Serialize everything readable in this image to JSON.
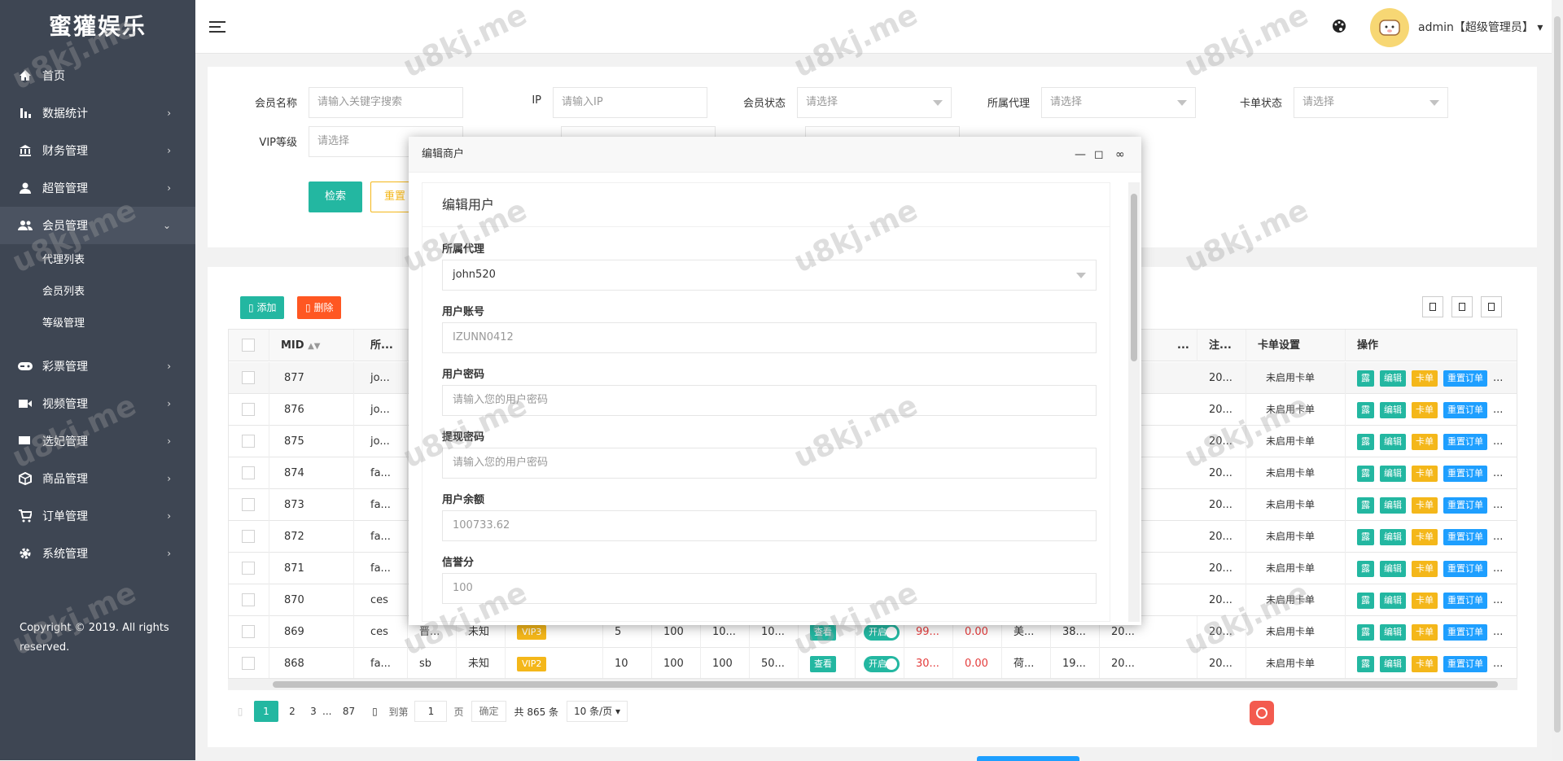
{
  "app": {
    "title": "蜜獾娱乐"
  },
  "sidebar": {
    "items": [
      {
        "label": "首页",
        "icon": "home-icon"
      },
      {
        "label": "数据统计",
        "icon": "bar-chart-icon"
      },
      {
        "label": "财务管理",
        "icon": "bank-icon"
      },
      {
        "label": "超管管理",
        "icon": "user-icon"
      },
      {
        "label": "会员管理",
        "icon": "users-icon"
      },
      {
        "label": "彩票管理",
        "icon": "gamepad-icon"
      },
      {
        "label": "视频管理",
        "icon": "video-icon"
      },
      {
        "label": "选妃管理",
        "icon": "flag-icon"
      },
      {
        "label": "商品管理",
        "icon": "box-icon"
      },
      {
        "label": "订单管理",
        "icon": "cart-icon"
      },
      {
        "label": "系统管理",
        "icon": "gear-icon"
      }
    ],
    "sub_items": [
      "代理列表",
      "会员列表",
      "等级管理"
    ],
    "copyright": "Copyright © 2019. All rights reserved."
  },
  "header": {
    "user": "admin【超级管理员】"
  },
  "filters": {
    "member_name": {
      "label": "会员名称",
      "placeholder": "请输入关键字搜索"
    },
    "ip": {
      "label": "IP",
      "placeholder": "请输入IP"
    },
    "member_status": {
      "label": "会员状态",
      "placeholder": "请选择"
    },
    "agent": {
      "label": "所属代理",
      "placeholder": "请选择"
    },
    "card_status": {
      "label": "卡单状态",
      "placeholder": "请选择"
    },
    "vip_level": {
      "label": "VIP等级",
      "placeholder": "请选择"
    },
    "search_btn": "检索",
    "reset_btn": "重置"
  },
  "toolbar": {
    "add": "添加",
    "delete": "删除"
  },
  "table": {
    "headers": {
      "mid": "MID",
      "agent": "所...",
      "reg": "注...",
      "card": "卡单设置",
      "ops": "操作",
      "trunc": "..."
    },
    "rows": [
      {
        "mid": "877",
        "agent": "jo...",
        "reg": "20...",
        "card": "未启用卡单"
      },
      {
        "mid": "876",
        "agent": "jo...",
        "reg": "20...",
        "card": "未启用卡单"
      },
      {
        "mid": "875",
        "agent": "jo...",
        "reg": "20...",
        "card": "未启用卡单"
      },
      {
        "mid": "874",
        "agent": "fa...",
        "reg": "20...",
        "card": "未启用卡单"
      },
      {
        "mid": "873",
        "agent": "fa...",
        "reg": "20...",
        "card": "未启用卡单"
      },
      {
        "mid": "872",
        "agent": "fa...",
        "reg": "20...",
        "card": "未启用卡单"
      },
      {
        "mid": "871",
        "agent": "fa...",
        "reg": "20...",
        "card": "未启用卡单"
      },
      {
        "mid": "870",
        "agent": "ces",
        "reg": "20...",
        "card": "未启用卡单"
      },
      {
        "mid": "869",
        "agent": "ces",
        "name": "晋...",
        "sex": "未知",
        "vip": "VIP3",
        "c1": "5",
        "c2": "100",
        "c3": "10...",
        "c4": "10...",
        "view": "查看",
        "toggle": "开启",
        "bal": "99...",
        "frozen": "0.00",
        "region": "美...",
        "c5": "38...",
        "reg": "20...",
        "card": "未启用卡单"
      },
      {
        "mid": "868",
        "agent": "fa...",
        "name": "sb",
        "sex": "未知",
        "vip": "VIP2",
        "c1": "10",
        "c2": "100",
        "c3": "100",
        "c4": "50...",
        "view": "查看",
        "toggle": "开启",
        "bal": "30...",
        "frozen": "0.00",
        "region": "荷...",
        "c5": "19...",
        "reg": "20...",
        "card": "未启用卡单"
      }
    ],
    "ops": {
      "dot": "露",
      "edit": "编辑",
      "card": "卡单",
      "reset": "重置订单",
      "more": "..."
    }
  },
  "pager": {
    "current": "1",
    "p2": "2",
    "p3": "3",
    "ellipsis": "...",
    "last": "87",
    "goto": "到第",
    "page_input": "1",
    "page": "页",
    "confirm": "确定",
    "total": "共 865 条",
    "per_page": "10 条/页"
  },
  "modal": {
    "title": "编辑商户",
    "subtitle": "编辑用户",
    "fields": {
      "agent": {
        "label": "所属代理",
        "value": "john520"
      },
      "account": {
        "label": "用户账号",
        "value": "IZUNN0412"
      },
      "password": {
        "label": "用户密码",
        "placeholder": "请输入您的用户密码"
      },
      "withdraw_pwd": {
        "label": "提现密码",
        "placeholder": "请输入您的用户密码"
      },
      "balance": {
        "label": "用户余额",
        "value": "100733.62"
      },
      "credit": {
        "label": "信誉分",
        "value": "100"
      }
    }
  },
  "watermark": "u8kj.me"
}
